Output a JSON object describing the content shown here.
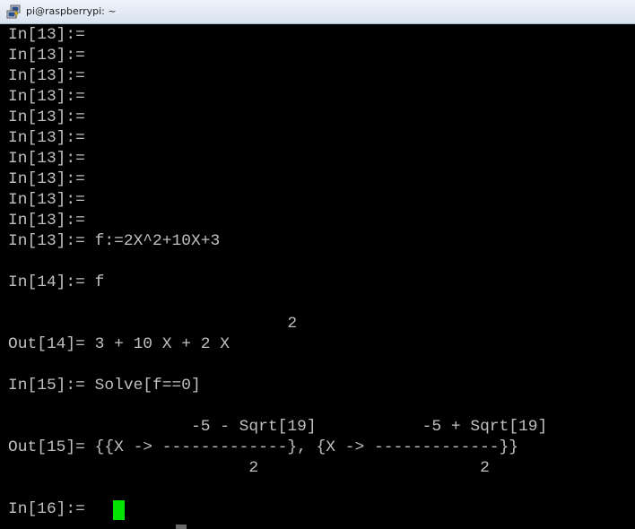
{
  "window": {
    "title": "pi@raspberrypi: ~",
    "app_icon": "putty-icon",
    "cursor_color": "#00e400",
    "text_color": "#c0c0c0",
    "background": "#000000"
  },
  "terminal": {
    "lines": [
      "In[13]:=",
      "In[13]:=",
      "In[13]:=",
      "In[13]:=",
      "In[13]:=",
      "In[13]:=",
      "In[13]:=",
      "In[13]:=",
      "In[13]:=",
      "In[13]:=",
      "In[13]:= f:=2X^2+10X+3",
      "",
      "In[14]:= f",
      "",
      "",
      "                             2",
      "Out[14]= 3 + 10 X + 2 X",
      "",
      "In[15]:= Solve[f==0]",
      "",
      "                   -5 - Sqrt[19]           -5 + Sqrt[19]",
      "Out[15]= {{X -> -------------}, {X -> -------------}}",
      "                         2                       2",
      "",
      "In[16]:= "
    ]
  }
}
